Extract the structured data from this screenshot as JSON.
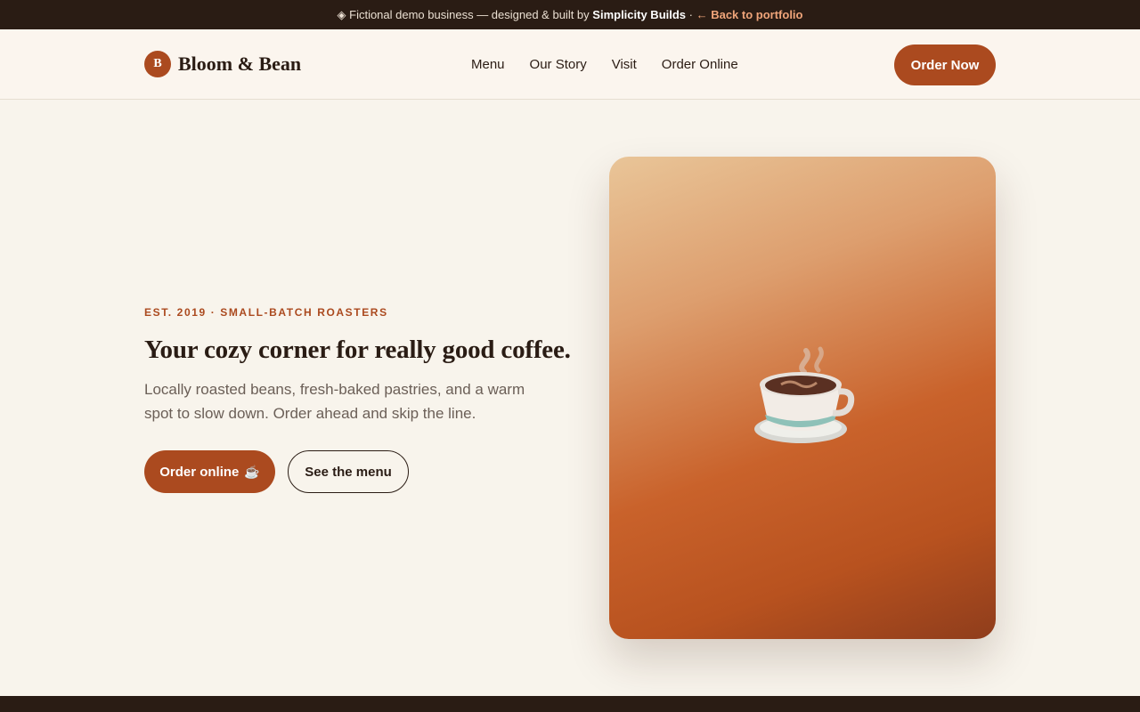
{
  "topbar": {
    "prefix": "◈ Fictional demo business — designed & built by ",
    "brand": "Simplicity Builds",
    "separator": " · ",
    "link": "← Back to portfolio"
  },
  "header": {
    "logo_initial": "B",
    "logo_text": "Bloom & Bean",
    "nav": [
      "Menu",
      "Our Story",
      "Visit",
      "Order Online"
    ],
    "cta": "Order Now"
  },
  "hero": {
    "eyebrow": "EST. 2019 · SMALL-BATCH ROASTERS",
    "headline": "Your cozy corner for really good coffee.",
    "subtext": "Locally roasted beans, fresh-baked pastries, and a warm spot to slow down. Order ahead and skip the line.",
    "primary_button": "Order online",
    "primary_button_icon": "☕",
    "secondary_button": "See the menu",
    "image_icon": "coffee-cup-icon"
  },
  "colors": {
    "accent": "#ab4a1f",
    "dark": "#2a1c14",
    "background": "#f8f4ec"
  }
}
